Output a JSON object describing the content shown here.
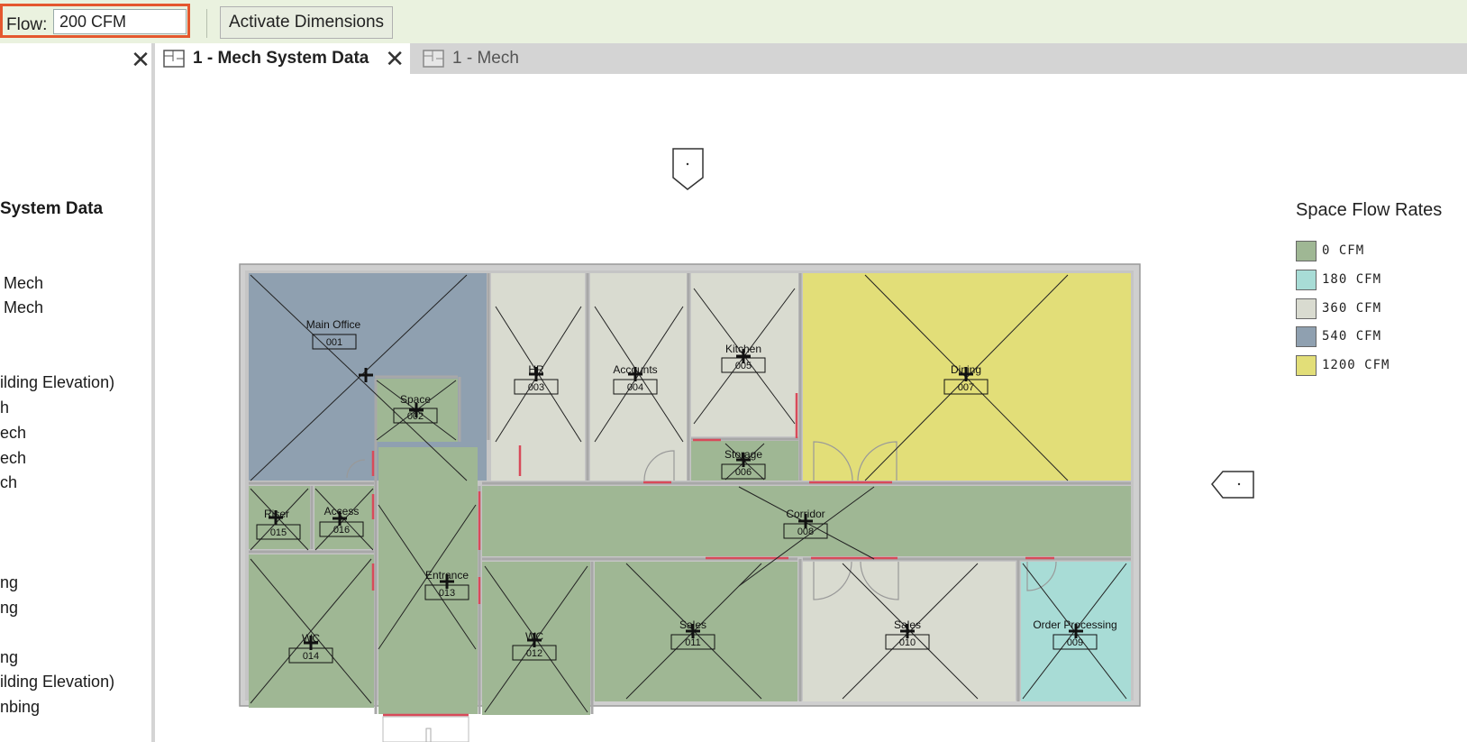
{
  "options_bar": {
    "flow_label": "Flow:",
    "flow_value": "200 CFM",
    "activate_dimensions_label": "Activate Dimensions"
  },
  "project_browser": {
    "items": [
      "System Data",
      "Mech",
      "Mech",
      "ilding Elevation)",
      "h",
      "ech",
      "ech",
      "ch",
      "ng",
      "ng",
      "ng",
      "ilding Elevation)",
      "nbing"
    ]
  },
  "tabs": [
    {
      "label": "1 - Mech System Data"
    },
    {
      "label": "1 - Mech"
    }
  ],
  "legend": {
    "title": "Space Flow Rates",
    "items": [
      {
        "label": "0 CFM",
        "color": "#9fb794"
      },
      {
        "label": "180 CFM",
        "color": "#a8dcd6"
      },
      {
        "label": "360 CFM",
        "color": "#d9dbd0"
      },
      {
        "label": "540 CFM",
        "color": "#8fa0b0"
      },
      {
        "label": "1200 CFM",
        "color": "#e2de78"
      }
    ]
  },
  "rooms": [
    {
      "name": "Main Office",
      "number": "001"
    },
    {
      "name": "Space",
      "number": "002"
    },
    {
      "name": "HR",
      "number": "003"
    },
    {
      "name": "Accounts",
      "number": "004"
    },
    {
      "name": "Kitchen",
      "number": "005"
    },
    {
      "name": "Storage",
      "number": "006"
    },
    {
      "name": "Dining",
      "number": "007"
    },
    {
      "name": "Corridor",
      "number": "008"
    },
    {
      "name": "Order Processing",
      "number": "009"
    },
    {
      "name": "Sales",
      "number": "010"
    },
    {
      "name": "Sales",
      "number": "011"
    },
    {
      "name": "WC",
      "number": "012"
    },
    {
      "name": "Entrance",
      "number": "013"
    },
    {
      "name": "WC",
      "number": "014"
    },
    {
      "name": "Riser",
      "number": "015"
    },
    {
      "name": "Access",
      "number": "016"
    }
  ]
}
